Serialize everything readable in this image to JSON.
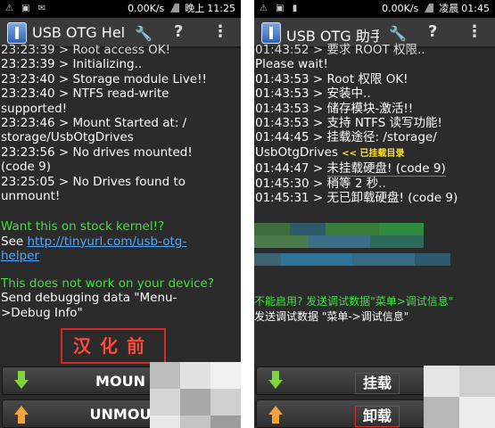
{
  "left": {
    "status": {
      "speed": "0.00K/s",
      "period": "晚上",
      "time": "11:25"
    },
    "app_title": "USB OTG Hel",
    "log_partial": "23:23:39 > Root access OK!",
    "log": [
      "23:23:39 > Initializing..",
      "23:23:40 > Storage module Live!!",
      "23:23:40 > NTFS read-write",
      "supported!",
      "23:23:46 > Mount Started at: /",
      "storage/UsbOtgDrives",
      "23:23:56 > No drives mounted!",
      "(code 9)",
      "23:25:05 > No Drives found to",
      "unmount!"
    ],
    "kernel_heading": "Want this on stock kernel!?",
    "see_label": "See",
    "link_line1": "http://tinyurl.com/usb-otg-",
    "link_line2": "helper",
    "device_heading": "This does not work on your device?",
    "debug_line1": "Send debugging data \"Menu-",
    "debug_line2": ">Debug Info\"",
    "stamp": "汉化前",
    "mount_label": "MOUN",
    "unmount_label": "UNMOU"
  },
  "right": {
    "status": {
      "speed": "0.00K/s",
      "period": "凌晨",
      "time": "01:45"
    },
    "app_title": "USB OTG 助手",
    "log_partial": "01:43:52 > 要求 ROOT 权限..",
    "log": [
      "Please wait!",
      "01:43:53 > Root 权限 OK!",
      "01:43:53 > 安装中..",
      "01:43:53 > 储存模块-激活!!",
      "01:43:53 > 支持 NTFS 读写功能!",
      "01:44:45 > 挂载途径: /storage/",
      "UsbOtgDrives"
    ],
    "mounted_tag": "<< 已挂载目录",
    "line_no_mount_prefix": "01:44:47 > ",
    "line_no_mount": "未挂载硬盘! (code 9)",
    "line_wait": "01:45:30 > 稍等 2 秒..",
    "line_no_unmount_prefix": "01:45:31 > ",
    "line_no_unmount": "无已卸载硬盘! (code 9)",
    "device_heading": "不能启用? 发送调试数据\"菜单>调试信息\"",
    "debug_line": "发送调试数据 \"菜单->调试信息\"",
    "mount_label": "挂载",
    "unmount_label": "卸载"
  },
  "colors": {
    "background": "#2b2b2b",
    "green_text": "#3ee23e",
    "link": "#52a7ff",
    "annotation_red": "#e23030",
    "annotation_blue": "#2b86ff"
  },
  "icons": {
    "wrench": "wrench-icon",
    "help": "help-icon",
    "overflow": "overflow-menu-icon",
    "mount": "mount-arrow-down-icon",
    "unmount": "unmount-arrow-up-icon"
  }
}
